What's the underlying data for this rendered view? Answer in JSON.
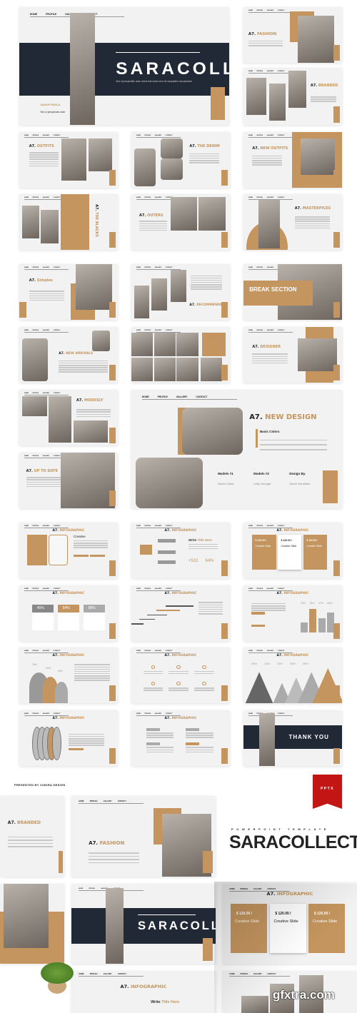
{
  "colors": {
    "accent": "#c4955e",
    "dark": "#212936",
    "slide_bg": "#f2f2f2",
    "ribbon": "#c41515"
  },
  "nav": [
    "HOME",
    "PROFILE",
    "GALLERY",
    "CONTACT"
  ],
  "hero": {
    "title": "SARACOLLECT",
    "subtitle": "Sed ut perspiciatis unde omnis iste natus error sit voluptatem accusantium",
    "name": "SARAH PRISCA",
    "name_sub": "Sed ut perspiciatis unde"
  },
  "slides": [
    {
      "prefix": "A7.",
      "accent": "FASHION"
    },
    {
      "prefix": "A7.",
      "accent": "BRANDED"
    },
    {
      "prefix": "A7.",
      "accent": "OUTFITS"
    },
    {
      "prefix": "A7.",
      "accent": "THE DENIM"
    },
    {
      "prefix": "A7.",
      "accent": "NEW OUTFITS"
    },
    {
      "prefix": "A7.",
      "accent": "THE BLACKS"
    },
    {
      "prefix": "A7.",
      "accent": "OUTERS"
    },
    {
      "prefix": "A7.",
      "accent": "MASTERPICES"
    },
    {
      "prefix": "A7.",
      "accent": "Simples"
    },
    {
      "prefix": "A7.",
      "accent": "RECOMMENDED"
    },
    {
      "prefix": "",
      "accent": "BREAK SECTION"
    },
    {
      "prefix": "A7.",
      "accent": "NEW ARRIVALS"
    },
    {
      "prefix": "",
      "accent": ""
    },
    {
      "prefix": "A7.",
      "accent": "DESIGNER"
    },
    {
      "prefix": "A7.",
      "accent": "MODESLY"
    },
    {
      "prefix": "A7.",
      "accent": "UP TO DATE"
    }
  ],
  "new_design": {
    "prefix": "A7.",
    "accent": "NEW DESIGN",
    "heading": "Basic Colors",
    "body": "Sed ut perspiciatis unde omnis iste natus error sit voluptatem accusantium",
    "models": [
      {
        "label": "Models #1",
        "value": "Gloria Claira"
      },
      {
        "label": "Models #2",
        "value": "Letty Georgia"
      },
      {
        "label": "Design By.",
        "value": "Sarah Geraldine"
      }
    ]
  },
  "infographic": {
    "prefix": "A7.",
    "accent": "INFOGRAPHIC",
    "percents_a": [
      "45%",
      "64%",
      "88%"
    ],
    "write_title": "Write",
    "write_accent": "Title Here",
    "stat1": "+532",
    "stat2": "64%",
    "creative": "Creative",
    "creative_accent": "Slide",
    "price": "$ 120.00 /",
    "price_card": "Creative Slide",
    "mountain_percents": [
      "45%",
      "12%",
      "23%",
      "34%",
      "45%"
    ],
    "bar_percents": [
      "34%",
      "78%",
      "47%",
      "65%"
    ],
    "bell_percents": [
      "23%",
      "34%",
      "45%"
    ]
  },
  "thank_you": "THANK YOU",
  "promo": {
    "presented_by": "PRESENTED BY VUNIRA DESIGN",
    "badge": "PPTX",
    "kicker": "POWERPOINT TEMPLATE",
    "title": "SARACOLLECT",
    "watermark": "gfxtra.com"
  }
}
